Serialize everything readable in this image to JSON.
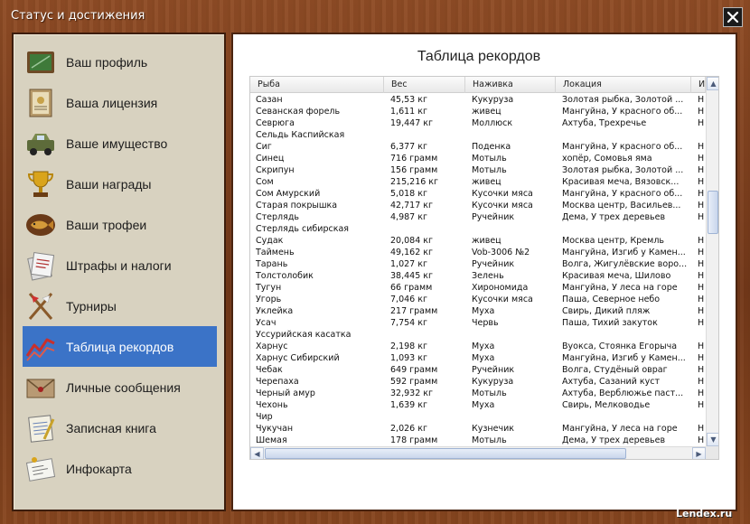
{
  "window": {
    "title": "Статус и достижения"
  },
  "sidebar": {
    "items": [
      {
        "label": "Ваш профиль",
        "icon": "profile-board-icon",
        "active": false
      },
      {
        "label": "Ваша лицензия",
        "icon": "license-certificate-icon",
        "active": false
      },
      {
        "label": "Ваше имущество",
        "icon": "property-truck-icon",
        "active": false
      },
      {
        "label": "Ваши награды",
        "icon": "trophy-cup-icon",
        "active": false
      },
      {
        "label": "Ваши трофеи",
        "icon": "fish-trophy-icon",
        "active": false
      },
      {
        "label": "Штрафы и налоги",
        "icon": "fines-papers-icon",
        "active": false
      },
      {
        "label": "Турниры",
        "icon": "tournament-flags-icon",
        "active": false
      },
      {
        "label": "Таблица рекордов",
        "icon": "records-chart-icon",
        "active": true
      },
      {
        "label": "Личные сообщения",
        "icon": "envelope-icon",
        "active": false
      },
      {
        "label": "Записная книга",
        "icon": "notebook-icon",
        "active": false
      },
      {
        "label": "Инфокарта",
        "icon": "infocard-icon",
        "active": false
      }
    ]
  },
  "main": {
    "title": "Таблица рекордов",
    "columns": [
      "Рыба",
      "Вес",
      "Наживка",
      "Локация",
      "И"
    ],
    "rows": [
      [
        "Сазан",
        "45,53 кг",
        "Кукуруза",
        "Золотая рыбка, Золотой ...",
        "Н"
      ],
      [
        "Севанская форель",
        "1,611 кг",
        "живец",
        "Мангуйна, У красного об...",
        "Н"
      ],
      [
        "Севрюга",
        "19,447 кг",
        "Моллюск",
        "Ахтуба, Трехречье",
        "Н"
      ],
      [
        "Сельдь Каспийская",
        "",
        "",
        "",
        ""
      ],
      [
        "Сиг",
        "6,377 кг",
        "Поденка",
        "Мангуйна, У красного об...",
        "Н"
      ],
      [
        "Синец",
        "716 грамм",
        "Мотыль",
        "хопёр, Сомовья яма",
        "Н"
      ],
      [
        "Скрипун",
        "156 грамм",
        "Мотыль",
        "Золотая рыбка, Золотой ...",
        "Н"
      ],
      [
        "Сом",
        "215,216 кг",
        "живец",
        "Красивая меча, Вязовск...",
        "Н"
      ],
      [
        "Сом Амурский",
        "5,018 кг",
        "Кусочки мяса",
        "Мангуйна, У красного об...",
        "Н"
      ],
      [
        "Старая покрышка",
        "42,717 кг",
        "Кусочки мяса",
        "Москва центр, Васильев...",
        "Н"
      ],
      [
        "Стерлядь",
        "4,987 кг",
        "Ручейник",
        "Дема, У трех деревьев",
        "Н"
      ],
      [
        "Стерлядь сибирская",
        "",
        "",
        "",
        ""
      ],
      [
        "Судак",
        "20,084 кг",
        "живец",
        "Москва центр, Кремль",
        "Н"
      ],
      [
        "Таймень",
        "49,162 кг",
        "Vob-3006 №2",
        "Мангуйна, Изгиб у Камен...",
        "Н"
      ],
      [
        "Тарань",
        "1,027 кг",
        "Ручейник",
        "Волга, Жигулёвские воро...",
        "Н"
      ],
      [
        "Толстолобик",
        "38,445 кг",
        "Зелень",
        "Красивая меча, Шилово",
        "Н"
      ],
      [
        "Тугун",
        "66 грамм",
        "Хирономида",
        "Мангуйна, У леса на горе",
        "Н"
      ],
      [
        "Угорь",
        "7,046 кг",
        "Кусочки мяса",
        "Паша, Северное небо",
        "Н"
      ],
      [
        "Уклейка",
        "217 грамм",
        "Муха",
        "Свирь, Дикий пляж",
        "Н"
      ],
      [
        "Усач",
        "7,754 кг",
        "Червь",
        "Паша, Тихий закуток",
        "Н"
      ],
      [
        "Уссурийская касатка",
        "",
        "",
        "",
        ""
      ],
      [
        "Харнус",
        "2,198 кг",
        "Муха",
        "Вуокса, Стоянка Егорыча",
        "Н"
      ],
      [
        "Харнус Сибирский",
        "1,093 кг",
        "Муха",
        "Мангуйна, Изгиб у Камен...",
        "Н"
      ],
      [
        "Чебак",
        "649 грамм",
        "Ручейник",
        "Волга, Студёный овраг",
        "Н"
      ],
      [
        "Черепаха",
        "592 грамм",
        "Кукуруза",
        "Ахтуба, Сазаний куст",
        "Н"
      ],
      [
        "Черный амур",
        "32,932 кг",
        "Мотыль",
        "Ахтуба, Верблюжье паст...",
        "Н"
      ],
      [
        "Чехонь",
        "1,639 кг",
        "Муха",
        "Свирь, Мелководье",
        "Н"
      ],
      [
        "Чир",
        "",
        "",
        "",
        ""
      ],
      [
        "Чукучан",
        "2,026 кг",
        "Кузнечик",
        "Мангуйна, У леса на горе",
        "Н"
      ],
      [
        "Шемая",
        "178 грамм",
        "Мотыль",
        "Дема, У трех деревьев",
        "Н"
      ]
    ]
  },
  "watermark": "Lendex.ru",
  "colors": {
    "active_item": "#3b73c7",
    "wood": "#7a3f1e",
    "sidebar_bg": "#d8d2c0"
  }
}
